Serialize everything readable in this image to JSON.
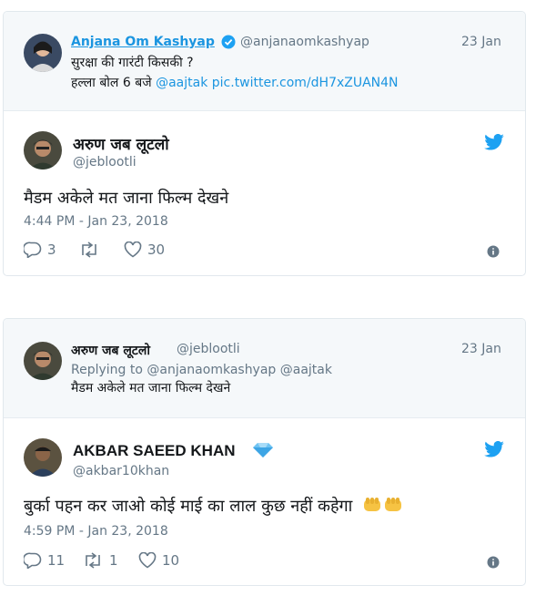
{
  "card1": {
    "quote": {
      "name": "Anjana Om Kashyap",
      "handle": "@anjanaomkashyap",
      "date": "23 Jan",
      "line1": "सुरक्षा की गारंटी किसकी ?",
      "line2_prefix": "हल्ला बोल 6 बजे",
      "line2_mention": "@aajtak",
      "line2_link": "pic.twitter.com/dH7xZUAN4N"
    },
    "tweet": {
      "name": "अरुण जब लूटलो",
      "handle": "@jeblootli",
      "text": "मैडम अकेले मत जाना फिल्म देखने",
      "timestamp": "4:44 PM - Jan 23, 2018",
      "replies": "3",
      "retweets": "",
      "likes": "30"
    }
  },
  "card2": {
    "quote": {
      "name": "अरुण जब लूटलो",
      "handle": "@jeblootli",
      "date": "23 Jan",
      "replying": "Replying to @anjanaomkashyap @aajtak",
      "text": "मैडम अकेले मत जाना फिल्म देखने"
    },
    "tweet": {
      "name": "AKBAR SAEED KHAN",
      "handle": "@akbar10khan",
      "text": "बुर्का पहन कर जाओ कोई माई का लाल कुछ नहीं कहेगा",
      "timestamp": "4:59 PM - Jan 23, 2018",
      "replies": "11",
      "retweets": "1",
      "likes": "10"
    }
  },
  "colors": {
    "accent": "#1da1f2",
    "link": "#1b95e0",
    "muted": "#657786"
  }
}
